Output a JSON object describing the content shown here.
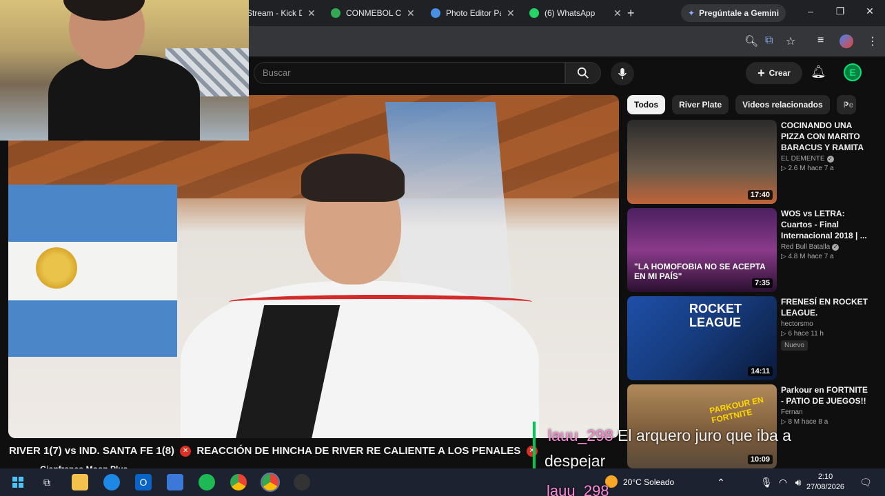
{
  "browser": {
    "tabs": [
      {
        "label": "Stream - Kick D",
        "color": "#53fc18"
      },
      {
        "label": "CONMEBOL Co",
        "color": "#34a853"
      },
      {
        "label": "Photo Editor Pa",
        "color": "#4a90e2"
      },
      {
        "label": "(6) WhatsApp",
        "color": "#25d366"
      }
    ],
    "new_tab": "+",
    "gemini_label": "Pregúntale a Gemini",
    "window_controls": {
      "minimize": "–",
      "maximize": "❐",
      "close": "✕"
    }
  },
  "youtube": {
    "search_placeholder": "Buscar",
    "create_label": "Crear",
    "avatar_letter": "E"
  },
  "video": {
    "title": "RIVER 1(7) vs IND. SANTA FE 1(8)",
    "title_tail": "REACCIÓN DE HINCHA DE RIVER RE CALIENTE A LOS PENALES",
    "channel_fragment": "Gianfranco Moon Plus"
  },
  "chips": [
    {
      "label": "Todos",
      "active": true
    },
    {
      "label": "River Plate",
      "active": false
    },
    {
      "label": "Videos relacionados",
      "active": false
    },
    {
      "label": "Pe",
      "active": false
    }
  ],
  "recommendations": [
    {
      "title": "COCINANDO UNA PIZZA CON MARITO BARACUS Y RAMITA",
      "channel": "EL DEMENTE",
      "verified": true,
      "stats": "▷ 2.6 M  hace 7 a",
      "duration": "17:40",
      "badge": "",
      "thumb_color": "#6b5a4a"
    },
    {
      "title": "WOS vs LETRA: Cuartos - Final Internacional 2018 | ...",
      "channel": "Red Bull Batalla",
      "verified": true,
      "stats": "▷ 4.8 M  hace 7 a",
      "duration": "7:35",
      "badge": "",
      "thumb_color": "#5a2d6e",
      "overlay_text": "\"LA HOMOFOBIA NO SE ACEPTA EN MI PAÍS\""
    },
    {
      "title": "FRENESÍ EN ROCKET LEAGUE.",
      "channel": "hectorsmo",
      "verified": false,
      "stats": "▷ 6  hace 11 h",
      "duration": "14:11",
      "badge": "Nuevo",
      "thumb_color": "#1e4fa8",
      "overlay_text": "ROCKET LEAGUE"
    },
    {
      "title": "Parkour en FORTNITE - PATIO DE JUEGOS!!",
      "channel": "Fernan",
      "verified": false,
      "stats": "▷ 8 M  hace 8 a",
      "duration": "10:09",
      "badge": "",
      "thumb_color": "#8a6a3a",
      "overlay_text": "PARKOUR EN FORTNITE"
    }
  ],
  "chat": [
    {
      "user": "lauu_298",
      "message": "El arquero juro que iba a",
      "user_color": "#ff8ad8"
    },
    {
      "user": "",
      "message": "despejar",
      "user_color": "#ff8ad8"
    },
    {
      "user": "lauu_298",
      "message": "",
      "user_color": "#ff8ad8"
    }
  ],
  "taskbar": {
    "weather": "20°C  Soleado",
    "time": "2:10",
    "date": "27/08/2026"
  }
}
